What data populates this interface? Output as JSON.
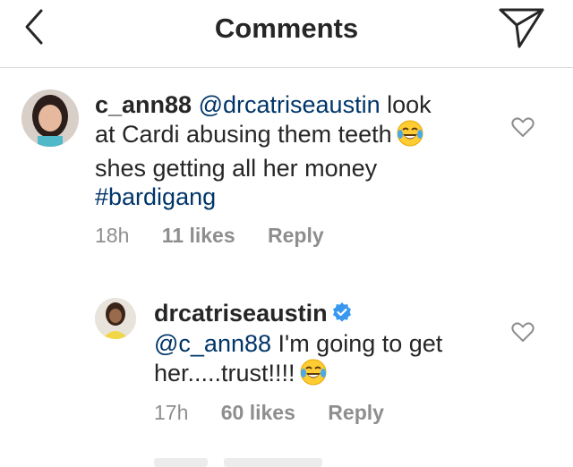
{
  "header": {
    "title": "Comments"
  },
  "comments": [
    {
      "username": "c_ann88",
      "mention": "@drcatriseaustin",
      "text_line1_suffix": "look",
      "line2": "at Cardi abusing them teeth",
      "line3": "shes getting all her  money",
      "hashtag": "#bardigang",
      "time": "18h",
      "likes": "11 likes",
      "reply": "Reply",
      "emoji": "laughing-tears-emoji"
    },
    {
      "username": "drcatriseaustin",
      "verified": true,
      "mention": "@c_ann88",
      "line1_suffix": "I'm going to get",
      "line2": "her.....trust!!!!",
      "time": "17h",
      "likes": "60 likes",
      "reply": "Reply",
      "emoji": "laughing-tears-emoji"
    }
  ],
  "icons": {
    "back": "chevron-left-icon",
    "share": "paper-plane-icon",
    "like": "heart-outline-icon"
  },
  "colors": {
    "link": "#003569",
    "meta": "#8e8e8e",
    "verified": "#3897f0",
    "divider": "#dbdbdb"
  }
}
